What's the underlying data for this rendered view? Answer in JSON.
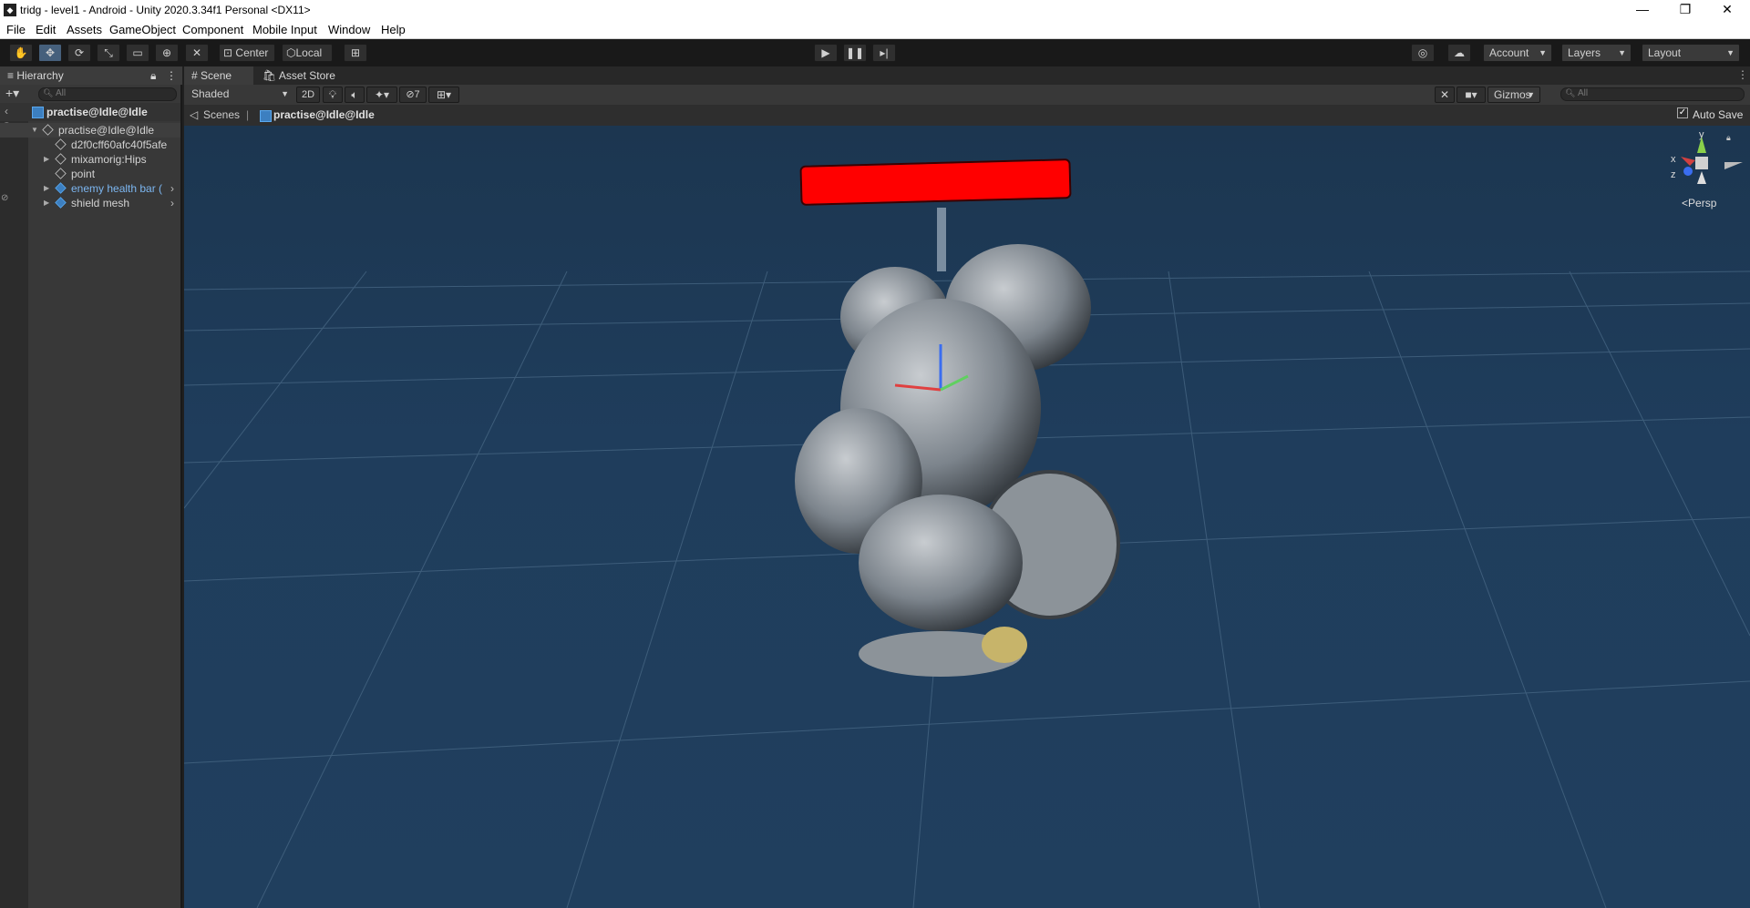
{
  "window": {
    "title": "tridg - level1 - Android - Unity 2020.3.34f1 Personal <DX11>",
    "controls": [
      "—",
      "❐",
      "✕"
    ]
  },
  "menu": [
    "File",
    "Edit",
    "Assets",
    "GameObject",
    "Component",
    "Mobile Input",
    "Window",
    "Help"
  ],
  "toolbar": {
    "pivot_label": "Center",
    "space_label": "Local",
    "account_label": "Account",
    "layers_label": "Layers",
    "layout_label": "Layout"
  },
  "hierarchy": {
    "tab_label": "Hierarchy",
    "search_placeholder": "All",
    "breadcrumb": "practise@Idle@Idle",
    "items": [
      {
        "label": "practise@Idle@Idle"
      },
      {
        "label": "d2f0cff60afc40f5afe"
      },
      {
        "label": "mixamorig:Hips"
      },
      {
        "label": "point"
      },
      {
        "label": "enemy health bar ("
      },
      {
        "label": "shield mesh"
      }
    ]
  },
  "scene": {
    "tabs": [
      "Scene",
      "Asset Store"
    ],
    "shading_mode": "Shaded",
    "mode_2d": "2D",
    "hidden_count": "7",
    "gizmos_label": "Gizmos",
    "search_placeholder": "All",
    "breadcrumb_root": "Scenes",
    "breadcrumb_prefab": "practise@Idle@Idle",
    "auto_save_label": "Auto Save",
    "auto_save_checked": true,
    "projection_label": "Persp",
    "axes": {
      "x": "x",
      "y": "y",
      "z": "z"
    },
    "health_bar_color": "#ff0000",
    "background_color": "#1f3d5c"
  }
}
